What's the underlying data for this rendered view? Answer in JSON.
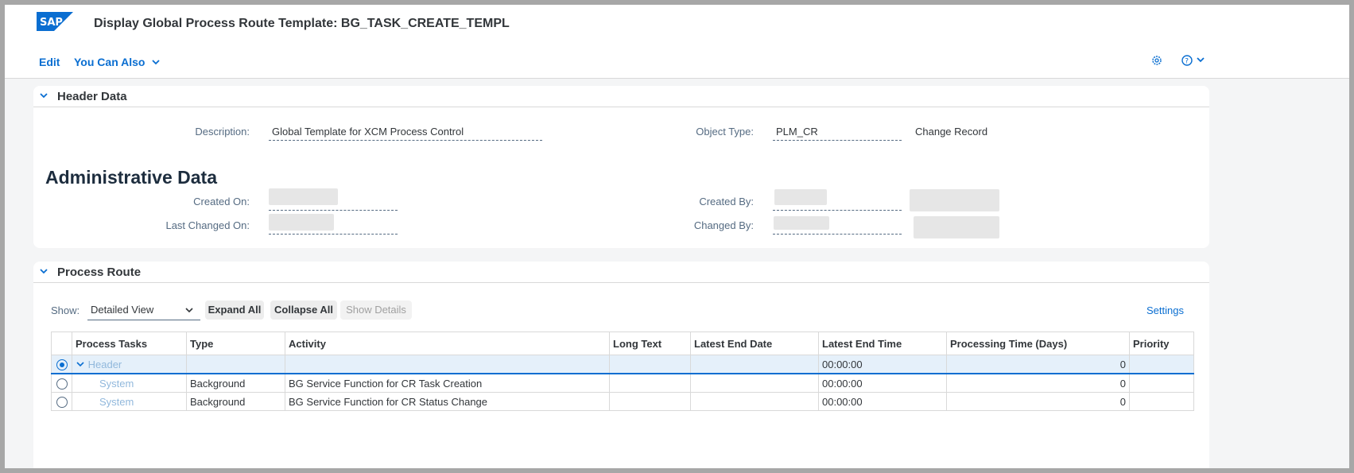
{
  "app": {
    "title": "Display Global Process Route Template: BG_TASK_CREATE_TEMPL",
    "logo_text": "SAP",
    "brand_color": "#0a6ed1"
  },
  "toolbar": {
    "edit_label": "Edit",
    "you_can_also_label": "You Can Also"
  },
  "header_data": {
    "title": "Header Data",
    "description_label": "Description:",
    "description_value": "Global Template for XCM Process Control",
    "object_type_label": "Object Type:",
    "object_type_value": "PLM_CR",
    "object_type_text": "Change Record"
  },
  "admin_data": {
    "title": "Administrative Data",
    "created_on_label": "Created On:",
    "last_changed_on_label": "Last Changed On:",
    "created_by_label": "Created By:",
    "changed_by_label": "Changed By:"
  },
  "process_route": {
    "title": "Process Route",
    "show_label": "Show:",
    "view_select": "Detailed View",
    "expand_all": "Expand All",
    "collapse_all": "Collapse All",
    "show_details": "Show Details",
    "settings": "Settings",
    "columns": [
      "Process Tasks",
      "Type",
      "Activity",
      "Long Text",
      "Latest End Date",
      "Latest End Time",
      "Processing Time (Days)",
      "Priority"
    ],
    "rows": [
      {
        "task": "Header",
        "type": "",
        "activity": "",
        "long_text": "",
        "end_date": "",
        "end_time": "00:00:00",
        "proc_time": "0",
        "priority": "",
        "selected": true
      },
      {
        "task": "System",
        "type": "Background",
        "activity": "BG Service Function for CR Task Creation",
        "long_text": "",
        "end_date": "",
        "end_time": "00:00:00",
        "proc_time": "0",
        "priority": "",
        "selected": false
      },
      {
        "task": "System",
        "type": "Background",
        "activity": "BG Service Function for CR Status Change",
        "long_text": "",
        "end_date": "",
        "end_time": "00:00:00",
        "proc_time": "0",
        "priority": "",
        "selected": false
      }
    ]
  }
}
